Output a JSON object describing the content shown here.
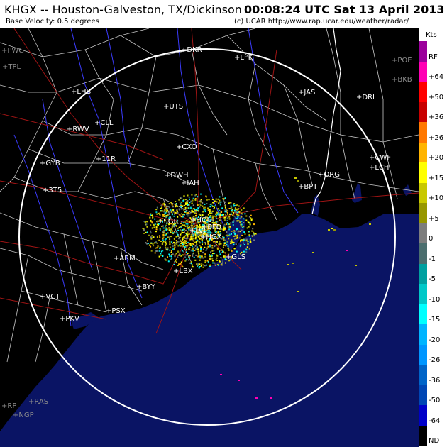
{
  "header": {
    "title": "KHGX -- Houston-Galveston, TX/Dickinson",
    "subtitle": "Base Velocity: 0.5 degrees",
    "timestamp": "00:08:24 UTC Sat 13 April 2013",
    "credit": "(c) UCAR  http://www.rap.ucar.edu/weather/radar/"
  },
  "legend": {
    "unit": "Kts",
    "items": [
      {
        "label": "RF",
        "color": "#9b009b"
      },
      {
        "label": "+64",
        "color": "#ff00b4"
      },
      {
        "label": "+50",
        "color": "#ff0000"
      },
      {
        "label": "+36",
        "color": "#c80000"
      },
      {
        "label": "+26",
        "color": "#ff7800"
      },
      {
        "label": "+20",
        "color": "#ffb400"
      },
      {
        "label": "+15",
        "color": "#ffff00"
      },
      {
        "label": "+10",
        "color": "#c8c800"
      },
      {
        "label": "+5",
        "color": "#969600"
      },
      {
        "label": "0",
        "color": "#7d7d7d"
      },
      {
        "label": "-1",
        "color": "#4b6e6e"
      },
      {
        "label": "-5",
        "color": "#00a0a0"
      },
      {
        "label": "-10",
        "color": "#00c8c8"
      },
      {
        "label": "-15",
        "color": "#00ffff"
      },
      {
        "label": "-20",
        "color": "#00b4ff"
      },
      {
        "label": "-26",
        "color": "#0096ff"
      },
      {
        "label": "-36",
        "color": "#0064c8"
      },
      {
        "label": "-50",
        "color": "#0046b4"
      },
      {
        "label": "-64",
        "color": "#0000c8"
      },
      {
        "label": "ND",
        "color": "#000000"
      }
    ]
  },
  "map": {
    "land_color": "#000000",
    "water_color": "#0a1464",
    "range_ring_color": "#ffffff",
    "county_color": "#c8c8c8",
    "road_color": "#a01414",
    "river_color": "#3c3cff",
    "cities": [
      {
        "name": "PWG",
        "gray": true
      },
      {
        "name": "TPL",
        "gray": true
      },
      {
        "name": "DKR",
        "gray": false
      },
      {
        "name": "LFK",
        "gray": false
      },
      {
        "name": "POE",
        "gray": true
      },
      {
        "name": "BKB",
        "gray": true
      },
      {
        "name": "LHB",
        "gray": false
      },
      {
        "name": "JAS",
        "gray": false
      },
      {
        "name": "DRI",
        "gray": false
      },
      {
        "name": "UTS",
        "gray": false
      },
      {
        "name": "CLL",
        "gray": false
      },
      {
        "name": "RWV",
        "gray": false
      },
      {
        "name": "CXO",
        "gray": false
      },
      {
        "name": "GYB",
        "gray": false
      },
      {
        "name": "11R",
        "gray": false
      },
      {
        "name": "CWF",
        "gray": false
      },
      {
        "name": "LCH",
        "gray": false
      },
      {
        "name": "DWH",
        "gray": false
      },
      {
        "name": "IAH",
        "gray": false
      },
      {
        "name": "ORG",
        "gray": false
      },
      {
        "name": "BPT",
        "gray": false
      },
      {
        "name": "3T5",
        "gray": false
      },
      {
        "name": "SGR",
        "gray": false
      },
      {
        "name": "HOU",
        "gray": false
      },
      {
        "name": "EFD",
        "gray": false
      },
      {
        "name": "LVJ",
        "gray": false
      },
      {
        "name": "HGX",
        "gray": false
      },
      {
        "name": "GLS",
        "gray": false
      },
      {
        "name": "ARM",
        "gray": false
      },
      {
        "name": "LBX",
        "gray": false
      },
      {
        "name": "BYY",
        "gray": false
      },
      {
        "name": "VCT",
        "gray": false
      },
      {
        "name": "PSX",
        "gray": false
      },
      {
        "name": "PKV",
        "gray": false
      },
      {
        "name": "RAS",
        "gray": true
      },
      {
        "name": "RP",
        "gray": true
      },
      {
        "name": "NGP",
        "gray": true
      }
    ]
  }
}
